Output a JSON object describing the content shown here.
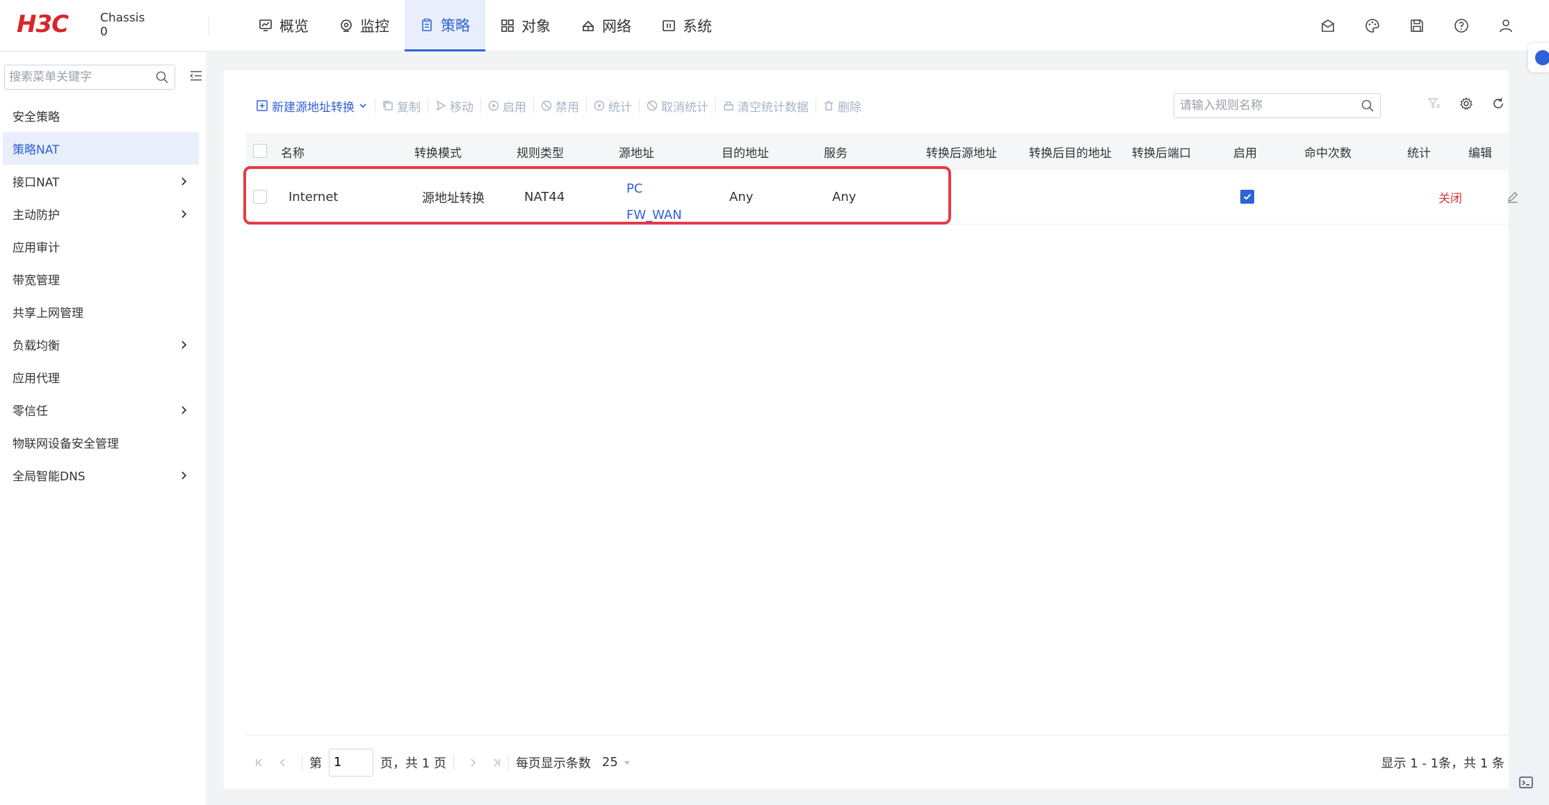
{
  "brand": {
    "logo_text": "H3C",
    "device_label": "Chassis",
    "device_num": "0"
  },
  "nav": [
    {
      "label": "概览",
      "icon": "dashboard-icon"
    },
    {
      "label": "监控",
      "icon": "monitor-icon"
    },
    {
      "label": "策略",
      "icon": "policy-icon",
      "active": true
    },
    {
      "label": "对象",
      "icon": "objects-icon"
    },
    {
      "label": "网络",
      "icon": "network-icon"
    },
    {
      "label": "系统",
      "icon": "system-icon"
    }
  ],
  "sidebar": {
    "search_placeholder": "搜索菜单关键字",
    "items": [
      {
        "label": "安全策略",
        "has_children": false
      },
      {
        "label": "策略NAT",
        "has_children": false,
        "active": true
      },
      {
        "label": "接口NAT",
        "has_children": true
      },
      {
        "label": "主动防护",
        "has_children": true
      },
      {
        "label": "应用审计",
        "has_children": false
      },
      {
        "label": "带宽管理",
        "has_children": false
      },
      {
        "label": "共享上网管理",
        "has_children": false
      },
      {
        "label": "负载均衡",
        "has_children": true
      },
      {
        "label": "应用代理",
        "has_children": false
      },
      {
        "label": "零信任",
        "has_children": true
      },
      {
        "label": "物联网设备安全管理",
        "has_children": false
      },
      {
        "label": "全局智能DNS",
        "has_children": true
      }
    ]
  },
  "toolbar": {
    "new_label": "新建源地址转换",
    "copy_label": "复制",
    "move_label": "移动",
    "enable_label": "启用",
    "disable_label": "禁用",
    "stats_label": "统计",
    "cancel_stats_label": "取消统计",
    "clear_stats_label": "清空统计数据",
    "delete_label": "删除",
    "search_placeholder": "请输入规则名称"
  },
  "table": {
    "headers": {
      "name": "名称",
      "mode": "转换模式",
      "rule_type": "规则类型",
      "src": "源地址",
      "dst": "目的地址",
      "service": "服务",
      "post_src": "转换后源地址",
      "post_dst": "转换后目的地址",
      "post_port": "转换后端口",
      "enabled": "启用",
      "hits": "命中次数",
      "stats": "统计",
      "edit": "编辑"
    },
    "rows": [
      {
        "name": "Internet",
        "mode": "源地址转换",
        "rule_type": "NAT44",
        "src_1": "PC",
        "src_2": "FW_WAN",
        "dst": "Any",
        "service": "Any",
        "post_src": "",
        "post_dst": "",
        "post_port": "",
        "enabled": true,
        "hits": "",
        "stats": "关闭"
      }
    ]
  },
  "pager": {
    "page_prefix": "第",
    "page_value": "1",
    "page_suffix": "页，共 1 页",
    "per_page_label": "每页显示条数",
    "per_page_value": "25",
    "summary": "显示 1 - 1条，共 1 条"
  },
  "colors": {
    "accent": "#2f62d6",
    "highlight": "#e53946",
    "disabled": "#a9b3c6"
  }
}
